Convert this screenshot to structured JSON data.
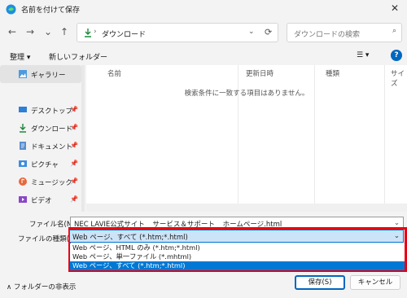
{
  "window": {
    "title": "名前を付けて保存",
    "close_icon": "close-icon"
  },
  "nav": {
    "back": "←",
    "forward": "→",
    "down": "⌄",
    "up": "↑"
  },
  "address": {
    "separator": "›",
    "path": "ダウンロード",
    "chevron": "⌄",
    "refresh": "⟳"
  },
  "search": {
    "placeholder": "ダウンロードの検索",
    "icon": "⌕"
  },
  "toolbar": {
    "organize": "整理 ▾",
    "new_folder": "新しいフォルダー",
    "view": "☰ ▾",
    "help": "?"
  },
  "sidebar": {
    "items": [
      {
        "label": "ギャラリー",
        "icon": "gallery-icon",
        "pinned": false,
        "selected": true
      },
      {
        "label": "デスクトップ",
        "icon": "desktop-icon",
        "pinned": true
      },
      {
        "label": "ダウンロード",
        "icon": "download-icon",
        "pinned": true
      },
      {
        "label": "ドキュメント",
        "icon": "document-icon",
        "pinned": true
      },
      {
        "label": "ピクチャ",
        "icon": "picture-icon",
        "pinned": true
      },
      {
        "label": "ミュージック",
        "icon": "music-icon",
        "pinned": true
      },
      {
        "label": "ビデオ",
        "icon": "video-icon",
        "pinned": true
      }
    ],
    "pin_glyph": "📌"
  },
  "columns": {
    "name": "名前",
    "modified": "更新日時",
    "type": "種類",
    "size": "サイズ"
  },
  "empty_message": "検索条件に一致する項目はありません。",
  "form": {
    "filename_label": "ファイル名(N):",
    "filename_value": "NEC LAVIE公式サイト _ サービス＆サポート _ ホームページ.html",
    "filetype_label": "ファイルの種類(T):",
    "filetype_value": "Web ページ、すべて (*.htm;*.html)",
    "options": [
      "Web ページ、HTML のみ (*.htm;*.html)",
      "Web ページ、単一ファイル (*.mhtml)",
      "Web ページ、すべて (*.htm;*.html)"
    ],
    "selected_option": 2,
    "chevron": "⌄"
  },
  "footer": {
    "hide_folders": "∧  フォルダーの非表示",
    "save": "保存(S)",
    "cancel": "キャンセル"
  },
  "colors": {
    "accent": "#0067c0",
    "highlight": "#e60012",
    "selection": "#0078d4"
  }
}
